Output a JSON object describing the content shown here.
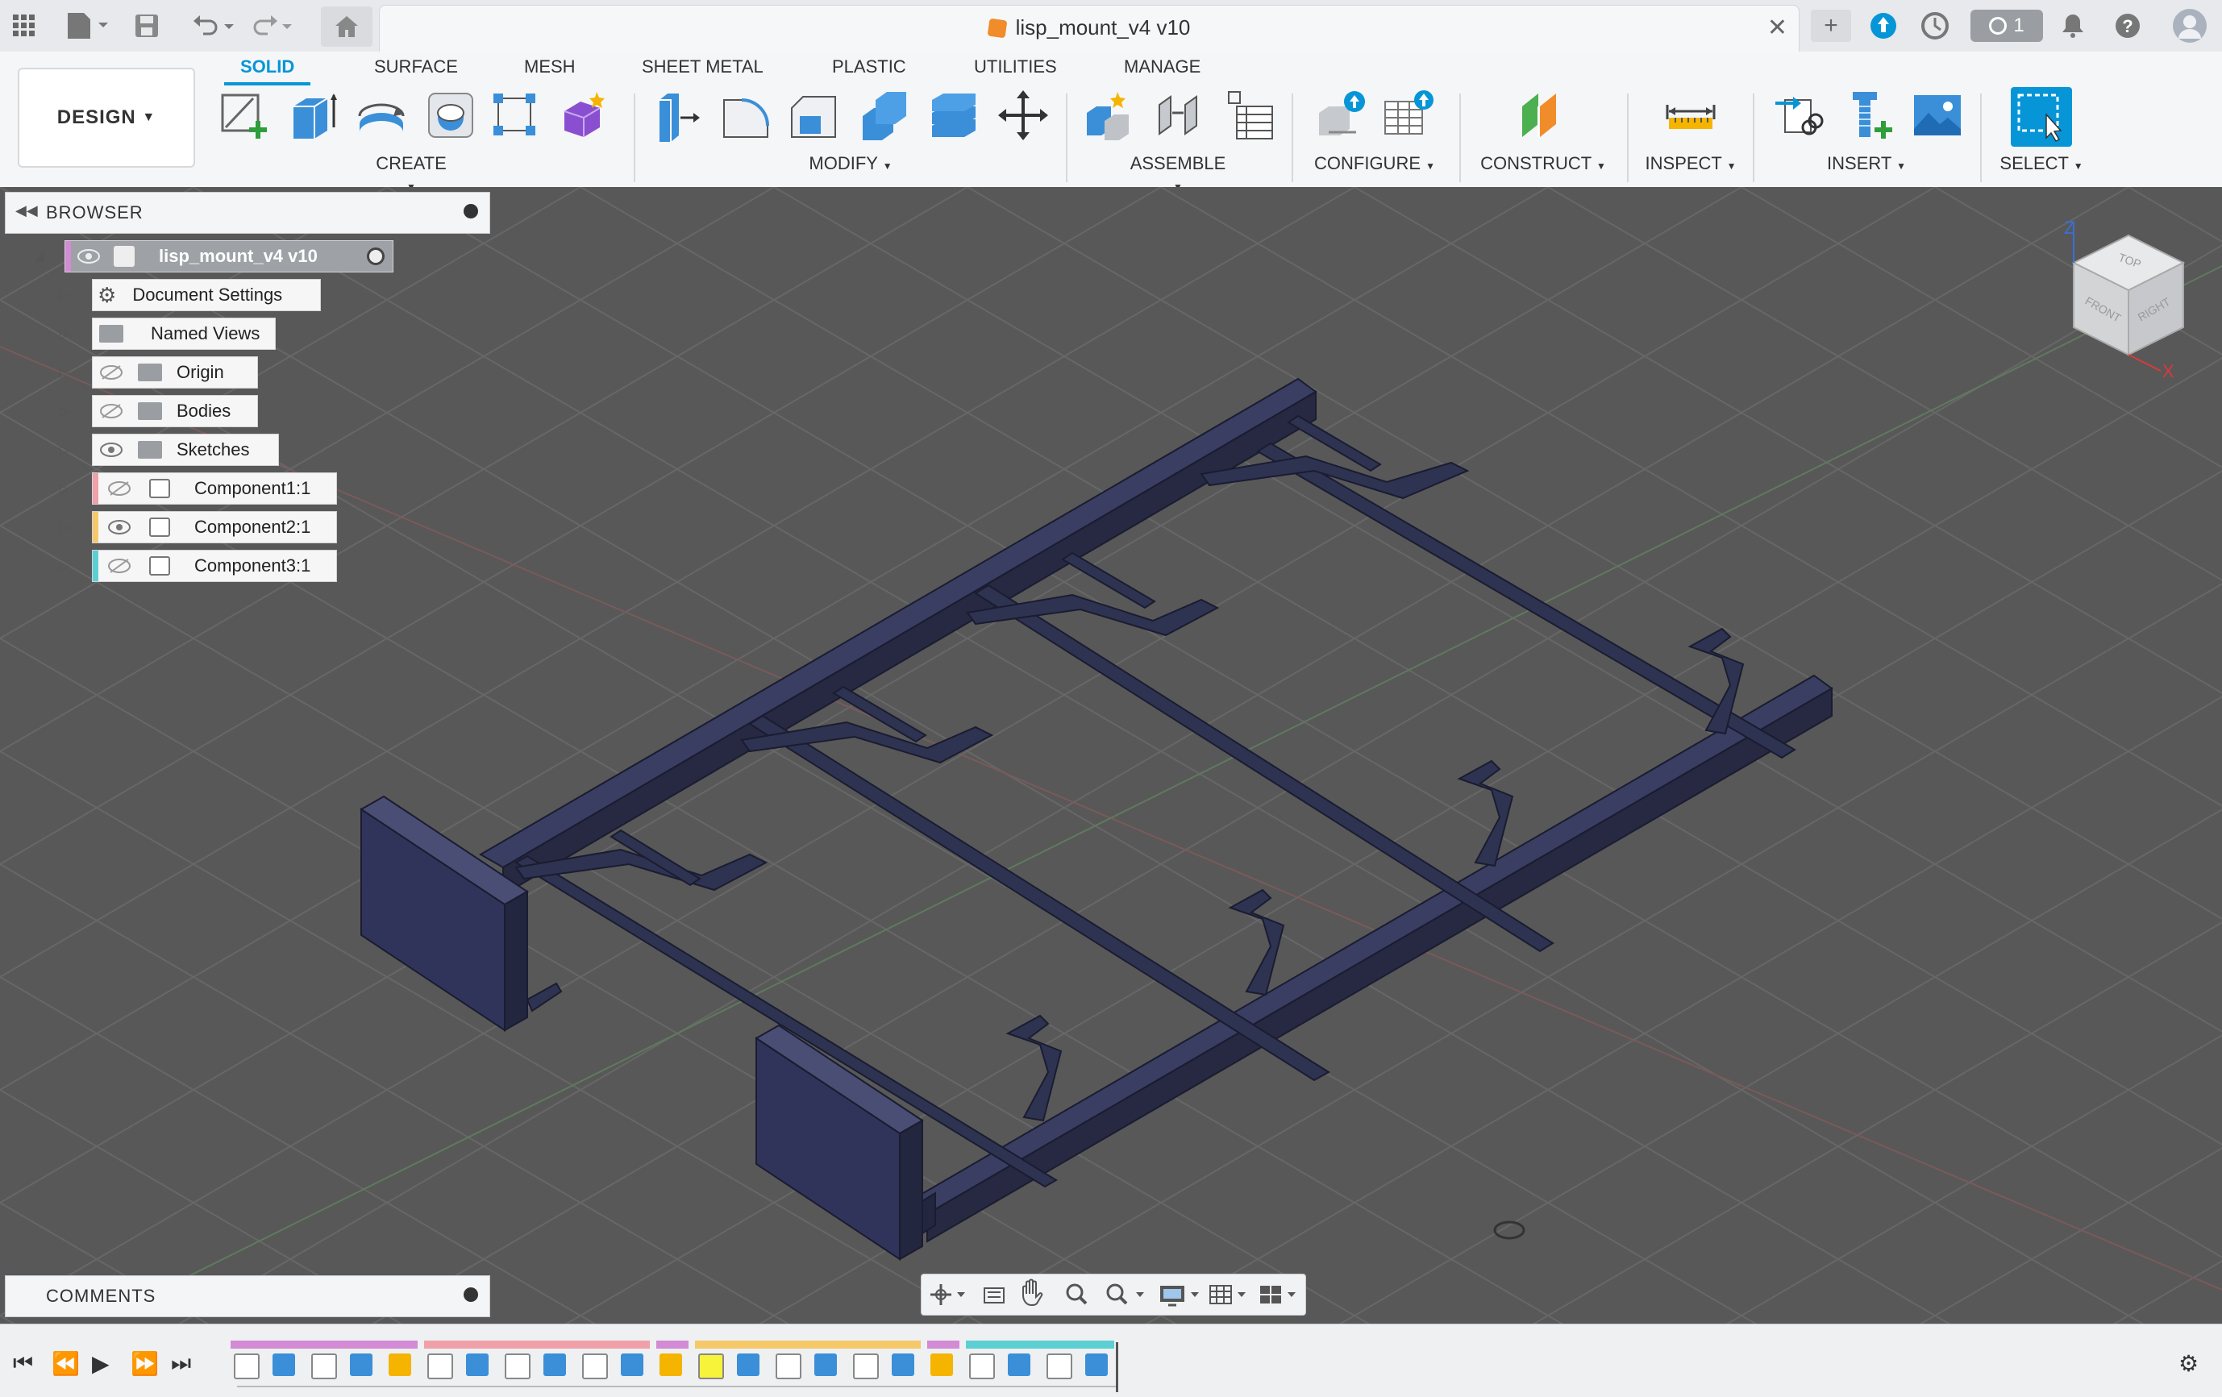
{
  "window": {
    "doc_title": "lisp_mount_v4 v10",
    "notification_count": "1"
  },
  "ribbon": {
    "workspace": "DESIGN",
    "tabs": [
      "SOLID",
      "SURFACE",
      "MESH",
      "SHEET METAL",
      "PLASTIC",
      "UTILITIES",
      "MANAGE"
    ],
    "active_tab": "SOLID",
    "groups": [
      "CREATE",
      "MODIFY",
      "ASSEMBLE",
      "CONFIGURE",
      "CONSTRUCT",
      "INSPECT",
      "INSERT",
      "SELECT"
    ]
  },
  "browser": {
    "title": "BROWSER",
    "root": "lisp_mount_v4 v10",
    "items": [
      {
        "label": "Document Settings",
        "icon": "gear-icon"
      },
      {
        "label": "Named Views",
        "icon": "folder-icon"
      },
      {
        "label": "Origin",
        "icon": "folder-icon",
        "visible": false
      },
      {
        "label": "Bodies",
        "icon": "folder-icon",
        "visible": false
      },
      {
        "label": "Sketches",
        "icon": "folder-icon",
        "visible": true
      },
      {
        "label": "Component1:1",
        "icon": "component-icon",
        "visible": false,
        "tag_color": "#f0a0a8"
      },
      {
        "label": "Component2:1",
        "icon": "component-icon",
        "visible": true,
        "tag_color": "#f5c86a"
      },
      {
        "label": "Component3:1",
        "icon": "component-icon",
        "visible": false,
        "tag_color": "#5ccfd3"
      }
    ]
  },
  "comments": {
    "title": "COMMENTS"
  },
  "viewcube": {
    "top": "TOP",
    "front": "FRONT",
    "right": "RIGHT",
    "z": "Z",
    "x": "X"
  },
  "colors": {
    "accent": "#0696d7",
    "model": "#2e3150",
    "viewport_bg": "#585858"
  }
}
